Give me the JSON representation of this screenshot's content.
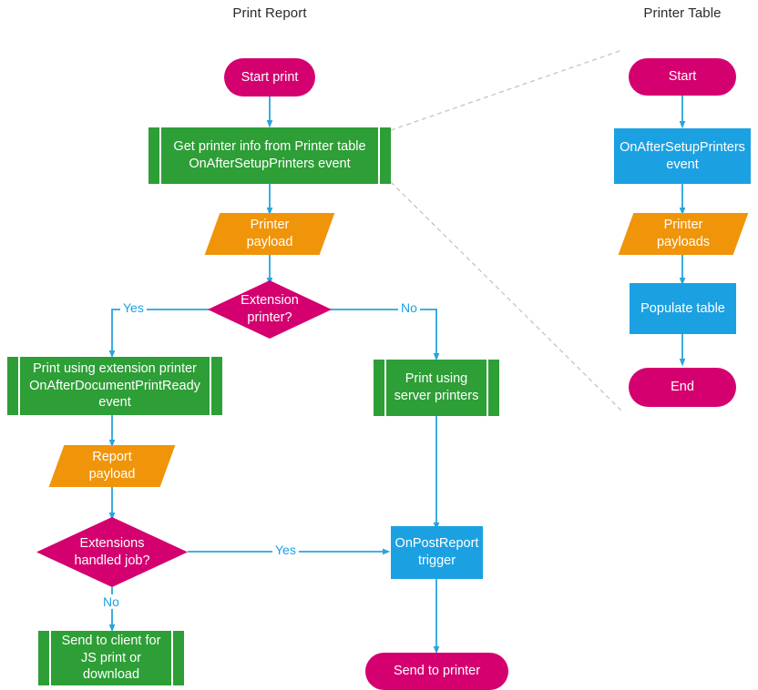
{
  "diagram": {
    "title_left": "Print Report",
    "title_right": "Printer Table",
    "colors": {
      "terminator": "#d4006f",
      "process": "#1ba1e2",
      "subroutine": "#2e9e37",
      "data": "#f0940a",
      "decision": "#d4006f",
      "connector": "#29a4dd",
      "callout": "#bfbfbf",
      "text_on_shape": "#ffffff",
      "title_text": "#2b2b2b"
    }
  },
  "nodes": {
    "start_print": {
      "label": "Start print",
      "shape": "terminator"
    },
    "get_printer_info": {
      "label": "Get printer info from Printer table\nOnAfterSetupPrinters event",
      "shape": "subroutine"
    },
    "printer_payload": {
      "label": "Printer\npayload",
      "shape": "data"
    },
    "extension_printer": {
      "label": "Extension\nprinter?",
      "shape": "decision"
    },
    "print_using_extension": {
      "label": "Print using extension printer\nOnAfterDocumentPrintReady\nevent",
      "shape": "subroutine"
    },
    "print_using_server": {
      "label": "Print using\nserver printers",
      "shape": "subroutine"
    },
    "report_payload": {
      "label": "Report\npayload",
      "shape": "data"
    },
    "extensions_handled": {
      "label": "Extensions\nhandled job?",
      "shape": "decision"
    },
    "send_to_client": {
      "label": "Send to client for\nJS print or\ndownload",
      "shape": "subroutine"
    },
    "on_post_report": {
      "label": "OnPostReport\ntrigger",
      "shape": "process"
    },
    "send_to_printer": {
      "label": "Send to printer",
      "shape": "terminator"
    },
    "pt_start": {
      "label": "Start",
      "shape": "terminator"
    },
    "pt_event": {
      "label": "OnAfterSetupPrinters\nevent",
      "shape": "process"
    },
    "pt_payloads": {
      "label": "Printer\npayloads",
      "shape": "data"
    },
    "pt_populate": {
      "label": "Populate table",
      "shape": "process"
    },
    "pt_end": {
      "label": "End",
      "shape": "terminator"
    }
  },
  "edge_labels": {
    "extension_yes": "Yes",
    "extension_no": "No",
    "handled_yes": "Yes",
    "handled_no": "No"
  }
}
